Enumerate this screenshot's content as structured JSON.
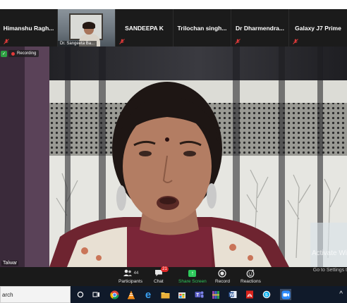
{
  "gallery": [
    {
      "name": "Himanshu  Ragh...",
      "type": "name"
    },
    {
      "name": "Dr. Sangeeta Ba...",
      "type": "video"
    },
    {
      "name": "SANDEEPA K",
      "type": "name"
    },
    {
      "name": "Trilochan  singh...",
      "type": "name"
    },
    {
      "name": "Dr  Dharmendra...",
      "type": "name"
    },
    {
      "name": "Galaxy J7 Prime",
      "type": "name"
    }
  ],
  "main_video": {
    "recording_label": "Recording",
    "speaker_name": "Talwar",
    "watermark": "Activate Wi",
    "watermark_sub": "Go to Settings t"
  },
  "toolbar": {
    "participants_label": "Participants",
    "participants_count": "44",
    "chat_label": "Chat",
    "chat_badge": "21",
    "share_label": "Share Screen",
    "record_label": "Record",
    "reactions_label": "Reactions"
  },
  "taskbar": {
    "search_text": "arch",
    "icons": [
      "cortana-icon",
      "task-view-icon",
      "chrome-icon",
      "vlc-icon",
      "edge-icon",
      "file-explorer-icon",
      "store-icon",
      "teams-icon",
      "winrar-icon",
      "word-icon",
      "acrobat-icon",
      "skype-icon",
      "zoom-icon"
    ]
  },
  "colors": {
    "toolbar_bg": "#1a1a1a",
    "share_green": "#2ec95c",
    "badge_red": "#e02828",
    "taskbar_bg": "#101a2a"
  }
}
